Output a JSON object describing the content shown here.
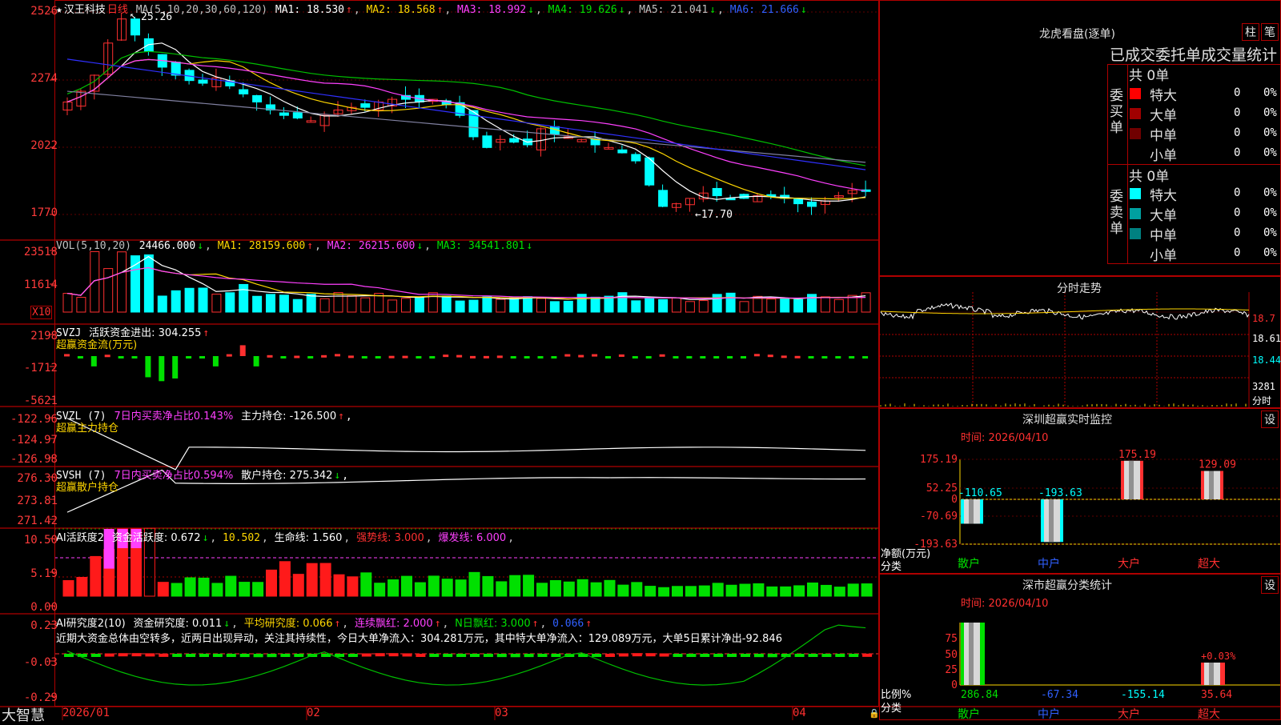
{
  "colors": {
    "up": "#ff3030",
    "down": "#00ffff",
    "grid": "#b00000",
    "ma1": "#ffffff",
    "ma2": "#ffd700",
    "ma3": "#ff40ff",
    "ma4": "#00c000",
    "ma5": "#8080a0",
    "ma6": "#3030ff"
  },
  "header": {
    "star": "★",
    "stock_name": "汉王科技",
    "period": "日线",
    "ma_label": "MA(5,10,20,30,60,120)",
    "ma1": "MA1: 18.530",
    "ma1_arrow": "↑",
    "ma2": "MA2: 18.568",
    "ma2_arrow": "↑",
    "ma3": "MA3: 18.992",
    "ma3_arrow": "↓",
    "ma4": "MA4: 19.626",
    "ma4_arrow": "↓",
    "ma5": "MA5: 21.041",
    "ma5_arrow": "↓",
    "ma6": "MA6: 21.666",
    "ma6_arrow": "↓"
  },
  "price_axis": [
    "2526",
    "2274",
    "2022",
    "1770"
  ],
  "annotations": {
    "high": "25.26",
    "low": "←17.70",
    "high_arrow": "↖"
  },
  "vol": {
    "label": "VOL(5,10,20)",
    "value": "24466.000",
    "value_arrow": "↓",
    "ma1": "MA1: 28159.600",
    "ma1_arrow": "↑",
    "ma2": "MA2: 26215.600",
    "ma2_arrow": "↓",
    "ma3": "MA3: 34541.801",
    "ma3_arrow": "↓",
    "axis": [
      "23518",
      "11614"
    ],
    "unit": "X10"
  },
  "svzj": {
    "label": "SVZJ",
    "title": "活跃资金进出: 304.255",
    "arrow": "↑",
    "sub": "超赢资金流(万元)",
    "axis": [
      "2198",
      "-1712",
      "-5621"
    ]
  },
  "svzl": {
    "label": "SVZL (7)",
    "ratio": "7日内买卖净占比0.143%",
    "main": "主力持仓: -126.500",
    "arrow": "↑",
    "comma": ",",
    "sub": "超赢主力持仓",
    "axis": [
      "-122.96",
      "-124.97",
      "-126.98"
    ]
  },
  "svsh": {
    "label": "SVSH (7)",
    "ratio": "7日内买卖净占比0.594%",
    "main": "散户持仓: 275.342",
    "arrow": "↓",
    "comma": ",",
    "sub": "超赢散户持仓",
    "axis": [
      "276.30",
      "273.81",
      "271.42"
    ]
  },
  "ai1": {
    "label": "AI活跃度2",
    "a": "资金活跃度: 0.672",
    "a_arrow": "↓",
    "b": "10.502",
    "c": "生命线: 1.560",
    "d": "强势线: 3.000",
    "e": "爆发线: 6.000",
    "axis": [
      "10.50",
      "5.19",
      "0.00"
    ]
  },
  "ai2": {
    "label": "AI研究度2(10)",
    "a": "资金研究度: 0.011",
    "a_arrow": "↓",
    "b": "平均研究度: 0.066",
    "b_arrow": "↑",
    "c": "连续飘红: 2.000",
    "c_arrow": "↑",
    "d": "N日飘红: 3.000",
    "d_arrow": "↑",
    "e": "0.066",
    "e_arrow": "↑",
    "comment": "近期大资金总体由空转多，近两日出现异动，关注其持续性，今日大单净流入：304.281万元，其中特大单净流入：129.089万元，大单5日累计净出-92.846",
    "axis": [
      "0.23",
      "-0.03",
      "-0.29"
    ]
  },
  "xaxis": {
    "brand": "大智慧",
    "labels": [
      "2026/01",
      "02",
      "03",
      "04"
    ]
  },
  "longhu": {
    "title": "龙虎看盘(逐单)",
    "btn1": "柱",
    "btn2": "笔",
    "subtitle": "已成交委托单成交量统计",
    "buy_side": "委买单",
    "buy_total": "共 0单",
    "sell_side": "委卖单",
    "sell_total": "共 0单",
    "buy_rows": [
      {
        "label": "特大",
        "count": "0",
        "pct": "0%",
        "color": "#ff0000"
      },
      {
        "label": "大单",
        "count": "0",
        "pct": "0%",
        "color": "#a00000"
      },
      {
        "label": "中单",
        "count": "0",
        "pct": "0%",
        "color": "#700000"
      },
      {
        "label": "小单",
        "count": "0",
        "pct": "0%",
        "color": "#000000"
      }
    ],
    "sell_rows": [
      {
        "label": "特大",
        "count": "0",
        "pct": "0%",
        "color": "#00ffff"
      },
      {
        "label": "大单",
        "count": "0",
        "pct": "0%",
        "color": "#00a0a0"
      },
      {
        "label": "中单",
        "count": "0",
        "pct": "0%",
        "color": "#008080"
      },
      {
        "label": "小单",
        "count": "0",
        "pct": "0%",
        "color": "#000000"
      }
    ]
  },
  "intraday": {
    "title": "分时走势",
    "axis": [
      "18.7",
      "18.61",
      "18.44"
    ],
    "vol": "3281",
    "vol_unit": "分时"
  },
  "monitor": {
    "title": "深圳超赢实时监控",
    "btn": "设",
    "time": "时间: 2026/04/10",
    "axis": [
      "175.19",
      "52.25",
      "0",
      "-70.69",
      "-193.63"
    ],
    "ylabel": "净额(万元)",
    "xlabel": "分类",
    "cats": [
      "散户",
      "中户",
      "大户",
      "超大"
    ],
    "values": [
      -110.65,
      -193.63,
      175.19,
      129.09
    ],
    "value_labels": [
      "-110.65",
      "-193.63",
      "175.19",
      "129.09"
    ]
  },
  "classify": {
    "title": "深市超赢分类统计",
    "btn": "设",
    "time": "时间: 2026/04/10",
    "axis": [
      "75",
      "50",
      "25",
      "0"
    ],
    "ylabel": "比例%",
    "xlabel": "分类",
    "cats": [
      "散户",
      "中户",
      "大户",
      "超大"
    ],
    "values": [
      286.84,
      -67.34,
      -155.14,
      35.64
    ],
    "value_labels": [
      "286.84",
      "-67.34",
      "-155.14",
      "35.64"
    ],
    "note": "+0.03%"
  }
}
